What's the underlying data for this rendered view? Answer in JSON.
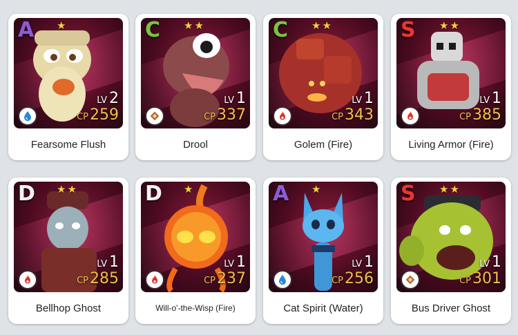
{
  "cards": [
    {
      "name": "Fearsome Flush",
      "rank": "A",
      "rank_color": "#8a5cd6",
      "stars": 1,
      "level_label": "LV",
      "level": "2",
      "cp_label": "CP",
      "cp": "259",
      "element": "water-icon"
    },
    {
      "name": "Drool",
      "rank": "C",
      "rank_color": "#7cc242",
      "stars": 2,
      "level_label": "LV",
      "level": "1",
      "cp_label": "CP",
      "cp": "337",
      "element": "earth-icon"
    },
    {
      "name": "Golem (Fire)",
      "rank": "C",
      "rank_color": "#7cc242",
      "stars": 2,
      "level_label": "LV",
      "level": "1",
      "cp_label": "CP",
      "cp": "343",
      "element": "fire-icon"
    },
    {
      "name": "Living Armor (Fire)",
      "rank": "S",
      "rank_color": "#e8372f",
      "stars": 2,
      "level_label": "LV",
      "level": "1",
      "cp_label": "CP",
      "cp": "385",
      "element": "fire-icon"
    },
    {
      "name": "Bellhop Ghost",
      "rank": "D",
      "rank_color": "#f2f2f2",
      "stars": 2,
      "level_label": "LV",
      "level": "1",
      "cp_label": "CP",
      "cp": "285",
      "element": "fire-icon"
    },
    {
      "name": "Will-o'-the-Wisp (Fire)",
      "rank": "D",
      "rank_color": "#f2f2f2",
      "stars": 1,
      "level_label": "LV",
      "level": "1",
      "cp_label": "CP",
      "cp": "237",
      "element": "fire-icon"
    },
    {
      "name": "Cat Spirit (Water)",
      "rank": "A",
      "rank_color": "#8a5cd6",
      "stars": 1,
      "level_label": "LV",
      "level": "1",
      "cp_label": "CP",
      "cp": "256",
      "element": "water-icon"
    },
    {
      "name": "Bus Driver Ghost",
      "rank": "S",
      "rank_color": "#e8372f",
      "stars": 2,
      "level_label": "LV",
      "level": "1",
      "cp_label": "CP",
      "cp": "301",
      "element": "earth-icon"
    }
  ],
  "colors": {
    "background": "#dfe3e8",
    "star": "#f5d23a",
    "cp": "#f0c24a",
    "water": "#2b86d9",
    "fire": "#d9342b",
    "earth": "#b8682e"
  }
}
